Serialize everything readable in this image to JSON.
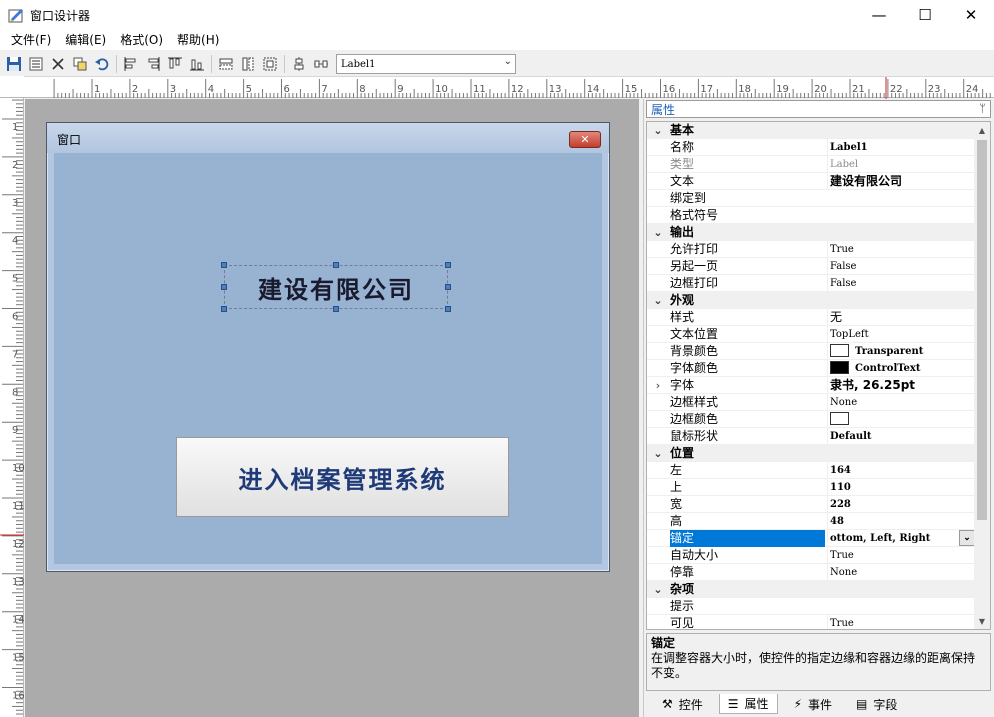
{
  "window": {
    "title": "窗口设计器",
    "minimize": "—",
    "maximize": "☐",
    "close": "✕"
  },
  "menu": [
    "文件(F)",
    "编辑(E)",
    "格式(O)",
    "帮助(H)"
  ],
  "toolbar": {
    "combo_value": "Label1"
  },
  "ruler": {
    "h_marks": [
      "1",
      "2",
      "3",
      "4",
      "5",
      "6",
      "7",
      "8",
      "9",
      "10",
      "11",
      "12",
      "13",
      "14",
      "15",
      "16",
      "17",
      "18",
      "19",
      "20",
      "21",
      "22",
      "23",
      "24"
    ],
    "v_marks": [
      "1",
      "2",
      "3",
      "4",
      "5",
      "6",
      "7",
      "8",
      "9",
      "10",
      "11",
      "12",
      "13",
      "14",
      "15",
      "16"
    ]
  },
  "form": {
    "title": "窗口",
    "label_text": "建设有限公司",
    "button_text": "进入档案管理系统"
  },
  "panel": {
    "header": "属性",
    "pin": "ᛘ",
    "rows": [
      {
        "type": "cat",
        "name": "基本",
        "exp": "⌄"
      },
      {
        "name": "名称",
        "value": "Label1",
        "style": "serifbold"
      },
      {
        "name": "类型",
        "value": "Label",
        "disabled": true
      },
      {
        "name": "文本",
        "value": "建设有限公司",
        "style": "bold"
      },
      {
        "name": "绑定到",
        "value": ""
      },
      {
        "name": "格式符号",
        "value": ""
      },
      {
        "type": "cat",
        "name": "输出",
        "exp": "⌄"
      },
      {
        "name": "允许打印",
        "value": "True"
      },
      {
        "name": "另起一页",
        "value": "False"
      },
      {
        "name": "边框打印",
        "value": "False"
      },
      {
        "type": "cat",
        "name": "外观",
        "exp": "⌄"
      },
      {
        "name": "样式",
        "value": "无",
        "style": "plain"
      },
      {
        "name": "文本位置",
        "value": "TopLeft"
      },
      {
        "name": "背景颜色",
        "value": "Transparent",
        "swatch": "#ffffff",
        "style": "serifbold"
      },
      {
        "name": "字体颜色",
        "value": "ControlText",
        "swatch": "#000000",
        "style": "serifbold"
      },
      {
        "name": "字体",
        "value": "隶书, 26.25pt",
        "style": "bold",
        "exp": "›"
      },
      {
        "name": "边框样式",
        "value": "None"
      },
      {
        "name": "边框颜色",
        "value": "",
        "swatch": "#ffffff"
      },
      {
        "name": "鼠标形状",
        "value": "Default",
        "style": "serifbold"
      },
      {
        "type": "cat",
        "name": "位置",
        "exp": "⌄"
      },
      {
        "name": "左",
        "value": "164",
        "style": "serifbold"
      },
      {
        "name": "上",
        "value": "110",
        "style": "serifbold"
      },
      {
        "name": "宽",
        "value": "228",
        "style": "serifbold"
      },
      {
        "name": "高",
        "value": "48",
        "style": "serifbold"
      },
      {
        "name": "锚定",
        "value": "ottom, Left, Right",
        "style": "serifbold",
        "selected": true,
        "dropdown": true
      },
      {
        "name": "自动大小",
        "value": "True"
      },
      {
        "name": "停靠",
        "value": "None"
      },
      {
        "type": "cat",
        "name": "杂项",
        "exp": "⌄"
      },
      {
        "name": "提示",
        "value": ""
      },
      {
        "name": "可见",
        "value": "True"
      }
    ],
    "desc_title": "锚定",
    "desc_text": "在调整容器大小时，使控件的指定边缘和容器边缘的距离保持不变。",
    "tabs": [
      {
        "label": "控件",
        "icon": "⚒",
        "icon_name": "tools-icon"
      },
      {
        "label": "属性",
        "icon": "☰",
        "icon_name": "properties-icon",
        "active": true
      },
      {
        "label": "事件",
        "icon": "⚡",
        "icon_name": "lightning-icon"
      },
      {
        "label": "字段",
        "icon": "▤",
        "icon_name": "fields-icon"
      }
    ]
  },
  "colors": {
    "accent": "#0078d7",
    "form_client": "#98b2d1",
    "canvas": "#ababab"
  }
}
